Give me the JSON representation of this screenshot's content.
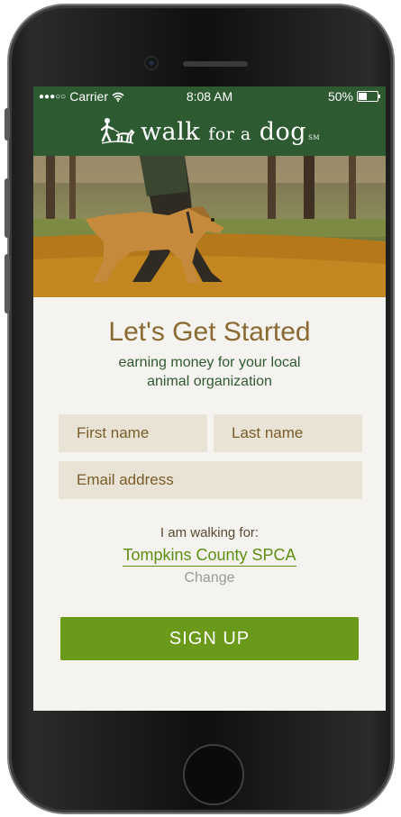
{
  "status": {
    "signal_dots": "●●●○○",
    "carrier": "Carrier",
    "wifi_icon": "wifi-icon",
    "time": "8:08 AM",
    "battery": "50%",
    "battery_level": 0.5
  },
  "app": {
    "logo_icon": "walker-and-dog-icon",
    "logo_walk": "walk",
    "logo_for_a": "for a",
    "logo_dog": "dog",
    "logo_sm": "SM"
  },
  "hero": {
    "image_icon": "dog-walk-photo"
  },
  "signup": {
    "headline": "Let's Get Started",
    "subtitle_line1": "earning money for your local",
    "subtitle_line2": "animal organization",
    "first_name_placeholder": "First name",
    "last_name_placeholder": "Last name",
    "email_placeholder": "Email address",
    "walking_for_label": "I am walking for:",
    "organization": "Tompkins County SPCA",
    "change_label": "Change",
    "button_label": "SIGN UP"
  },
  "colors": {
    "header_green": "#2e5a31",
    "accent_green": "#6b9a1a",
    "headline_gold": "#8a6a33"
  }
}
